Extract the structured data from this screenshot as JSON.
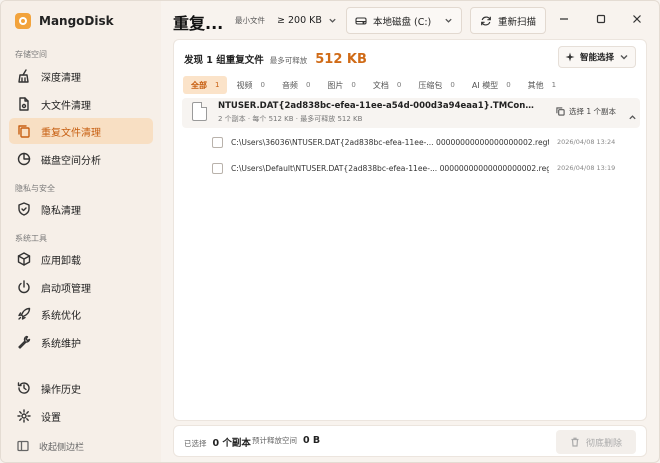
{
  "app": {
    "name": "MangoDisk",
    "accent_color": "#d06b17",
    "active_bg": "#f8dfc3"
  },
  "sidebar": {
    "sections": [
      {
        "title": "存储空间"
      },
      {
        "title": "隐私与安全"
      },
      {
        "title": "系统工具"
      }
    ],
    "items": [
      {
        "label": "深度清理",
        "icon": "broom-icon"
      },
      {
        "label": "大文件清理",
        "icon": "file-icon"
      },
      {
        "label": "重复文件清理",
        "icon": "copy-icon",
        "active": true
      },
      {
        "label": "磁盘空间分析",
        "icon": "pie-chart-icon"
      },
      {
        "label": "隐私清理",
        "icon": "shield-icon"
      },
      {
        "label": "应用卸载",
        "icon": "package-icon"
      },
      {
        "label": "启动项管理",
        "icon": "power-icon"
      },
      {
        "label": "系统优化",
        "icon": "rocket-icon"
      },
      {
        "label": "系统维护",
        "icon": "wrench-icon"
      },
      {
        "label": "操作历史",
        "icon": "history-icon"
      },
      {
        "label": "设置",
        "icon": "gear-icon"
      }
    ],
    "collapse_label": "收起侧边栏"
  },
  "header": {
    "title": "重复...",
    "min_size_label": "最小文件",
    "min_size_value": "≥ 200 KB",
    "disk_label": "本地磁盘 (C:)",
    "rescan_label": "重新扫描"
  },
  "summary": {
    "found_text": "发现 1 组重复文件",
    "max_free_label": "最多可释放",
    "max_free_value": "512 KB",
    "smart_select_label": "智能选择"
  },
  "tabs": [
    {
      "label": "全部",
      "count": "1",
      "active": true
    },
    {
      "label": "视频",
      "count": "0"
    },
    {
      "label": "音频",
      "count": "0"
    },
    {
      "label": "图片",
      "count": "0"
    },
    {
      "label": "文档",
      "count": "0"
    },
    {
      "label": "压缩包",
      "count": "0"
    },
    {
      "label": "AI 模型",
      "count": "0"
    },
    {
      "label": "其他",
      "count": "1"
    }
  ],
  "group": {
    "name": "NTUSER.DAT{2ad838bc-efea-11ee-a54d-000d3a94eaa1}.TMContainer000000000...",
    "meta": "2 个副本 · 每个 512 KB · 最多可释放 512 KB",
    "select_one_label": "选择 1 个副本",
    "files": [
      {
        "path": "C:\\Users\\36036\\NTUSER.DAT{2ad838bc-efea-11ee-...  00000000000000000002.regtrans-ms",
        "time": "2026/04/08 13:24"
      },
      {
        "path": "C:\\Users\\Default\\NTUSER.DAT{2ad838bc-efea-11ee-...  00000000000000000002.regtrans-ms",
        "time": "2026/04/08 13:19"
      }
    ]
  },
  "footer": {
    "selected_label": "已选择",
    "selected_value": "0 个副本",
    "est_free_label": "预计释放空间",
    "est_free_value": "0 B",
    "delete_label": "彻底删除"
  }
}
